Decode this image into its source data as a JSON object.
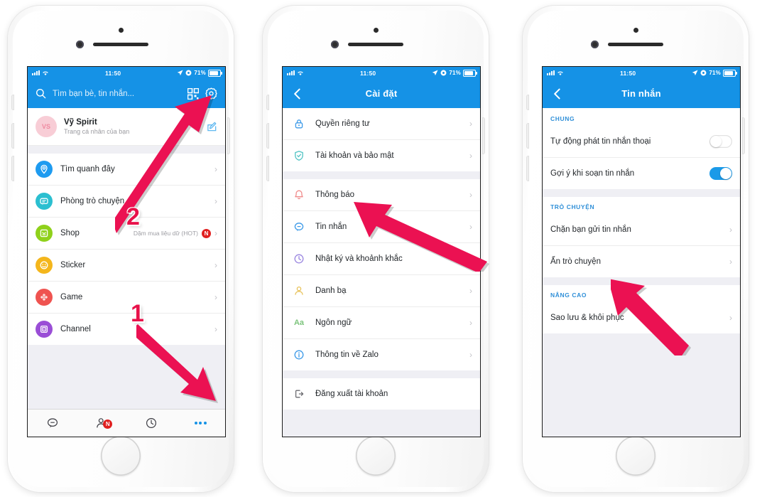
{
  "status_bar": {
    "time": "11:50",
    "battery_pct": "71%"
  },
  "phone1": {
    "search": {
      "placeholder": "Tìm bạn bè, tin nhắn...",
      "search_icon": "search-icon",
      "qr_icon": "qr-code-icon",
      "gear_icon": "gear-icon"
    },
    "profile": {
      "name": "Vỹ Spirit",
      "subtitle": "Trang cá nhân của bạn",
      "avatar_initials": "VS",
      "edit_icon": "edit-icon"
    },
    "items": [
      {
        "label": "Tìm quanh đây",
        "icon": "location-pin-icon",
        "color": "#1e9bf0",
        "chevron": "›"
      },
      {
        "label": "Phòng trò chuyện",
        "icon": "chat-room-icon",
        "color": "#2bbfd0",
        "chevron": "›"
      },
      {
        "label": "Shop",
        "icon": "shop-bag-icon",
        "color": "#8fd11b",
        "chevron": "›",
        "subtitle": "Dặm mua liệu dữ (HOT)",
        "badge": "N"
      },
      {
        "label": "Sticker",
        "icon": "smiley-icon",
        "color": "#f4b61c",
        "chevron": "›"
      },
      {
        "label": "Game",
        "icon": "gamepad-icon",
        "color": "#ef5350",
        "chevron": "›"
      },
      {
        "label": "Channel",
        "icon": "channel-icon",
        "color": "#9a4ed6",
        "chevron": "›"
      }
    ],
    "tabbar": [
      {
        "icon": "message-bubble-icon",
        "badge": ""
      },
      {
        "icon": "contacts-person-icon",
        "badge": "N"
      },
      {
        "icon": "timeline-clock-icon",
        "badge": ""
      },
      {
        "icon": "more-dots-icon",
        "badge": ""
      }
    ]
  },
  "phone2": {
    "nav": {
      "title": "Cài đặt",
      "back_icon": "chevron-left-icon"
    },
    "groups": [
      {
        "items": [
          {
            "label": "Quyền riêng tư",
            "icon": "lock-icon",
            "color": "#3d9ae8",
            "chevron": "›"
          },
          {
            "label": "Tài khoản và bảo mật",
            "icon": "shield-icon",
            "color": "#4fc3c3",
            "chevron": "›"
          }
        ]
      },
      {
        "items": [
          {
            "label": "Thông báo",
            "icon": "bell-icon",
            "color": "#f08a8a",
            "chevron": "›"
          },
          {
            "label": "Tin nhắn",
            "icon": "message-bubble-icon",
            "color": "#3d9ae8",
            "chevron": "›"
          },
          {
            "label": "Nhật ký và khoảnh khắc",
            "icon": "clock-icon",
            "color": "#9a86e0",
            "chevron": "›"
          },
          {
            "label": "Danh bạ",
            "icon": "person-icon",
            "color": "#e8c25a",
            "chevron": "›"
          },
          {
            "label": "Ngôn ngữ",
            "icon": "language-aa-icon",
            "color": "#7cc47c",
            "chevron": "›"
          },
          {
            "label": "Thông tin về Zalo",
            "icon": "info-circle-icon",
            "color": "#3d9ae8",
            "chevron": "›"
          }
        ]
      },
      {
        "items": [
          {
            "label": "Đăng xuất tài khoản",
            "icon": "logout-icon",
            "color": "#6b6b70",
            "chevron": ""
          }
        ]
      }
    ]
  },
  "phone3": {
    "nav": {
      "title": "Tin nhắn",
      "back_icon": "chevron-left-icon"
    },
    "sections": [
      {
        "header": "CHUNG",
        "rows": [
          {
            "label": "Tự động phát tin nhắn thoại",
            "control": "toggle",
            "state": "off"
          },
          {
            "label": "Gợi ý khi soạn tin nhắn",
            "control": "toggle",
            "state": "on"
          }
        ]
      },
      {
        "header": "TRÒ CHUYỆN",
        "rows": [
          {
            "label": "Chặn bạn gửi tin nhắn",
            "control": "chevron",
            "chevron": "›"
          },
          {
            "label": "Ẩn trò chuyện",
            "control": "chevron",
            "chevron": "›"
          }
        ]
      },
      {
        "header": "NÂNG CAO",
        "rows": [
          {
            "label": "Sao lưu & khôi phục",
            "control": "chevron",
            "chevron": "›"
          }
        ]
      }
    ]
  },
  "annotations": [
    {
      "number": "1",
      "target": "more-tab-button"
    },
    {
      "number": "2",
      "target": "gear-icon"
    },
    {
      "number": "",
      "target": "tin-nhan-settings-row"
    },
    {
      "number": "",
      "target": "sao-luu-khoi-phuc-row"
    }
  ],
  "colors": {
    "brand_blue": "#1592e6",
    "accent_red": "#e8124a",
    "badge_red": "#e02020",
    "toggle_on": "#1b9ae8"
  }
}
